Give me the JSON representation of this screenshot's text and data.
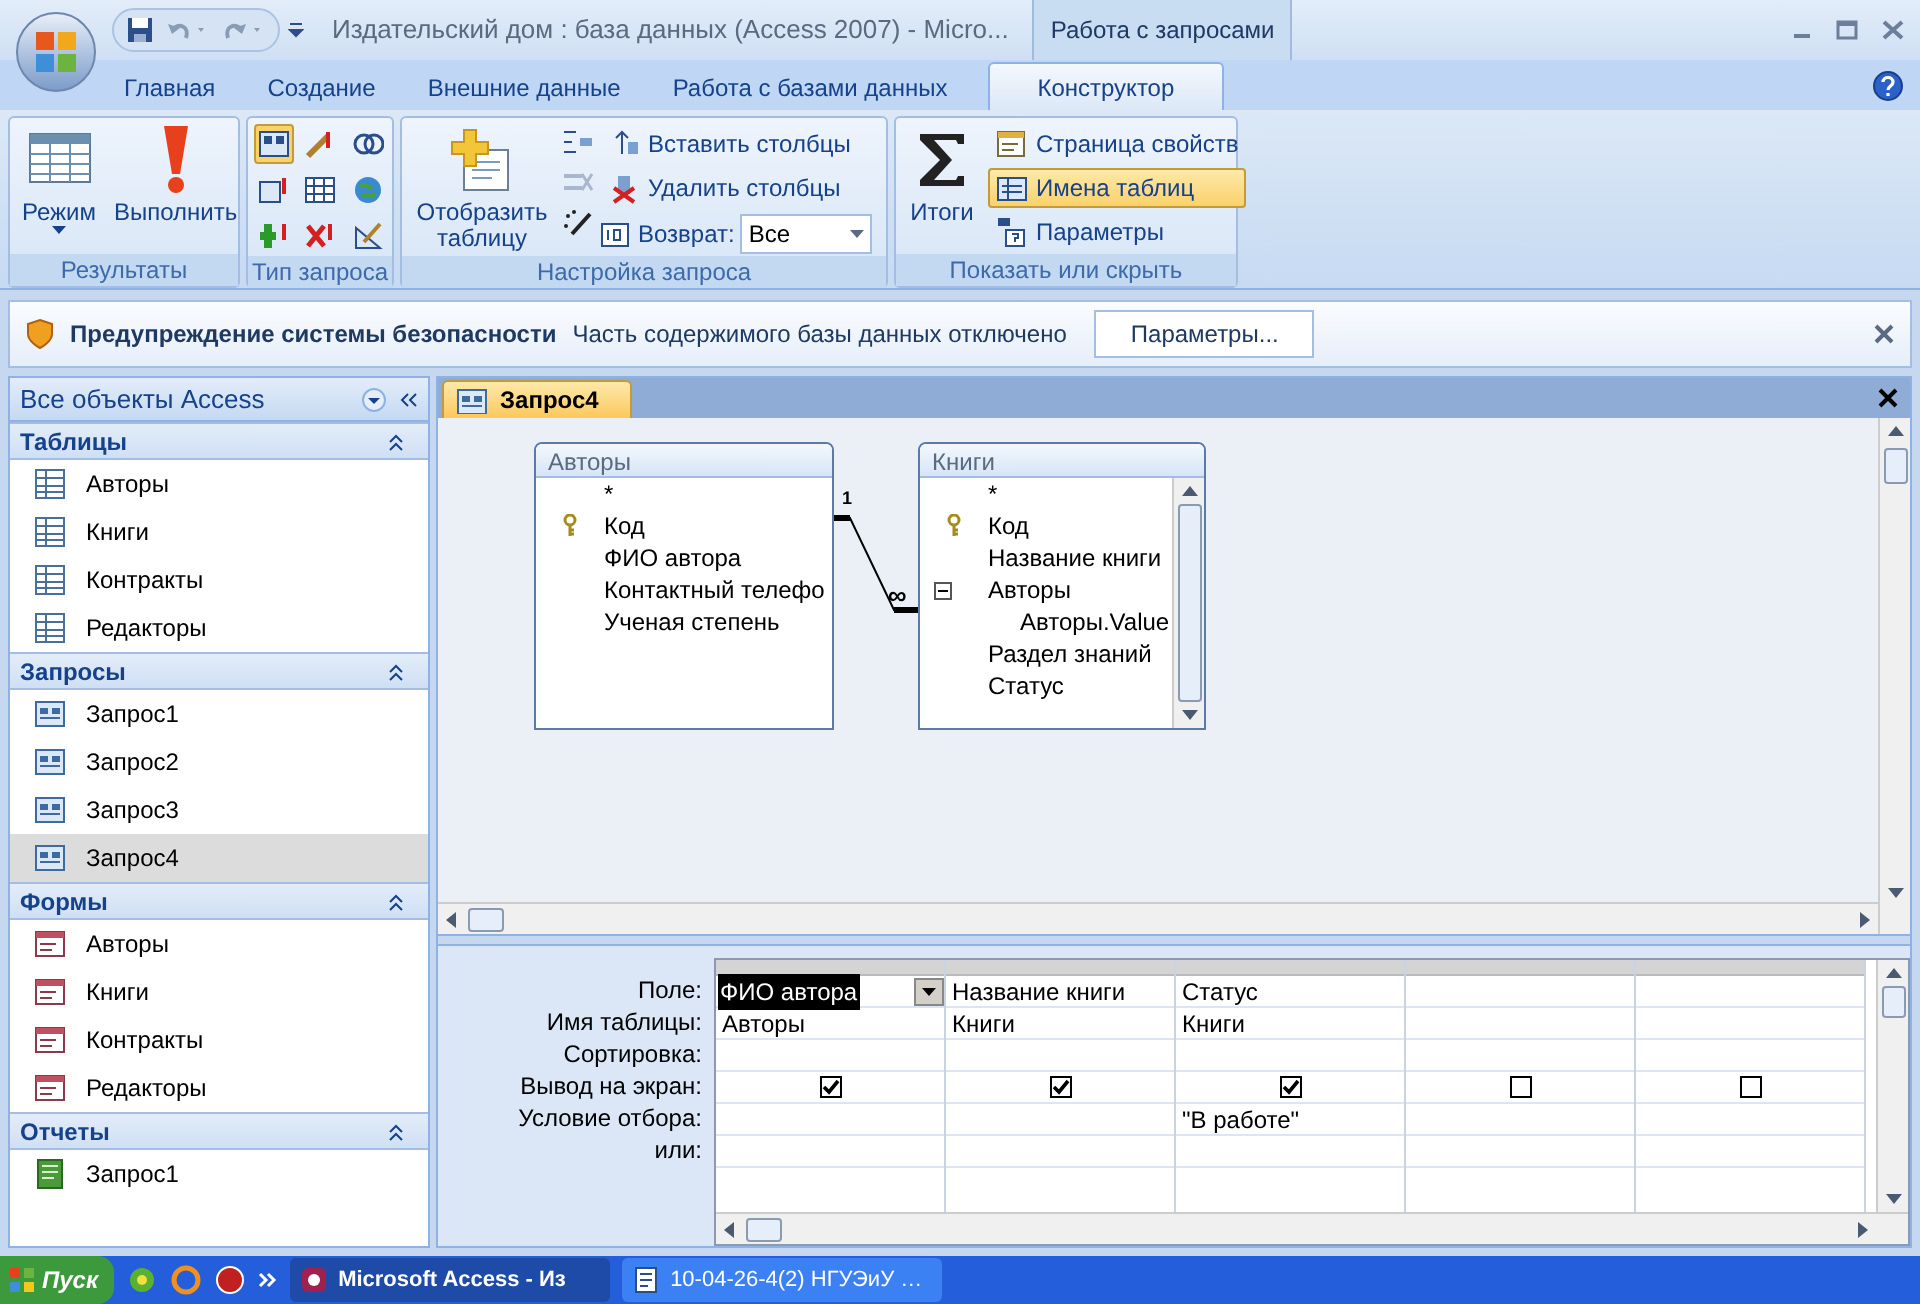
{
  "window": {
    "title": "Издательский дом : база данных (Access 2007) - Micro...",
    "context_label": "Работа с запросами"
  },
  "tabs": [
    {
      "label": "Главная",
      "selected": false
    },
    {
      "label": "Создание",
      "selected": false
    },
    {
      "label": "Внешние данные",
      "selected": false
    },
    {
      "label": "Работа с базами данных",
      "selected": false
    },
    {
      "label": "Конструктор",
      "selected": true
    }
  ],
  "ribbon": {
    "groups": [
      {
        "label": "Результаты",
        "commands": [
          {
            "kind": "large",
            "label": "Режим",
            "selected": false
          },
          {
            "kind": "large",
            "label": "Выполнить",
            "selected": false
          }
        ]
      },
      {
        "label": "Тип запроса",
        "query_type_buttons": [
          {
            "selected": true
          },
          {
            "selected": false
          },
          {
            "selected": false
          },
          {
            "selected": false
          },
          {
            "selected": false
          },
          {
            "selected": false
          },
          {
            "selected": false
          },
          {
            "selected": false
          },
          {
            "selected": false
          }
        ]
      },
      {
        "label": "Настройка запроса",
        "commands": [
          {
            "kind": "large",
            "label": "Отобразить таблицу",
            "selected": false
          },
          {
            "kind": "small",
            "label": "Вставить столбцы",
            "selected": false
          },
          {
            "kind": "small",
            "label": "Удалить столбцы",
            "selected": false
          },
          {
            "kind": "dropdown",
            "label": "Возврат:",
            "value": "Все"
          }
        ]
      },
      {
        "label": "Показать или скрыть",
        "commands": [
          {
            "kind": "large",
            "label": "Итоги",
            "selected": false
          },
          {
            "kind": "small",
            "label": "Страница свойств",
            "selected": false
          },
          {
            "kind": "small",
            "label": "Имена таблиц",
            "selected": true
          },
          {
            "kind": "small",
            "label": "Параметры",
            "selected": false
          }
        ]
      }
    ]
  },
  "security_bar": {
    "title": "Предупреждение системы безопасности",
    "message": "Часть содержимого базы данных отключено",
    "button": "Параметры..."
  },
  "navigation": {
    "header": "Все объекты Access",
    "groups": [
      {
        "title": "Таблицы",
        "kind": "table",
        "items": [
          {
            "label": "Авторы",
            "selected": false
          },
          {
            "label": "Книги",
            "selected": false
          },
          {
            "label": "Контракты",
            "selected": false
          },
          {
            "label": "Редакторы",
            "selected": false
          }
        ]
      },
      {
        "title": "Запросы",
        "kind": "query",
        "items": [
          {
            "label": "Запрос1",
            "selected": false
          },
          {
            "label": "Запрос2",
            "selected": false
          },
          {
            "label": "Запрос3",
            "selected": false
          },
          {
            "label": "Запрос4",
            "selected": true
          }
        ]
      },
      {
        "title": "Формы",
        "kind": "form",
        "items": [
          {
            "label": "Авторы",
            "selected": false
          },
          {
            "label": "Книги",
            "selected": false
          },
          {
            "label": "Контракты",
            "selected": false
          },
          {
            "label": "Редакторы",
            "selected": false
          }
        ]
      },
      {
        "title": "Отчеты",
        "kind": "report",
        "items": [
          {
            "label": "Запрос1",
            "selected": false
          }
        ]
      }
    ]
  },
  "document_tab": "Запрос4",
  "tables": [
    {
      "title": "Авторы",
      "fields": [
        {
          "label": "*",
          "kind": "plain"
        },
        {
          "label": "Код",
          "kind": "key"
        },
        {
          "label": "ФИО автора",
          "kind": "plain"
        },
        {
          "label": "Контактный телефо",
          "kind": "plain"
        },
        {
          "label": "Ученая степень",
          "kind": "plain"
        }
      ]
    },
    {
      "title": "Книги",
      "fields": [
        {
          "label": "*",
          "kind": "plain"
        },
        {
          "label": "Код",
          "kind": "key"
        },
        {
          "label": "Название книги",
          "kind": "plain"
        },
        {
          "label": "Авторы",
          "kind": "expander"
        },
        {
          "label": "Авторы.Value",
          "kind": "sub"
        },
        {
          "label": "Раздел знаний",
          "kind": "plain"
        },
        {
          "label": "Статус",
          "kind": "plain"
        }
      ]
    }
  ],
  "relationship": {
    "one": "1",
    "many": "∞"
  },
  "grid": {
    "row_labels": [
      "Поле:",
      "Имя таблицы:",
      "Сортировка:",
      "Вывод на экран:",
      "Условие отбора:",
      "или:"
    ],
    "columns": [
      {
        "field": "ФИО автора",
        "table": "Авторы",
        "show": true,
        "selected": true
      },
      {
        "field": "Название книги",
        "table": "Книги",
        "show": true,
        "selected": false
      },
      {
        "field": "Статус",
        "table": "Книги",
        "show": true,
        "criteria": "\"В работе\"",
        "selected": false
      },
      {
        "show": false,
        "selected": false
      },
      {
        "show": false,
        "selected": false
      }
    ]
  },
  "taskbar": {
    "start": "Пуск",
    "items": [
      {
        "label": "Microsoft Access - Из",
        "selected": true
      },
      {
        "label": "10-04-26-4(2) НГУЭиУ …",
        "selected": false
      }
    ]
  }
}
